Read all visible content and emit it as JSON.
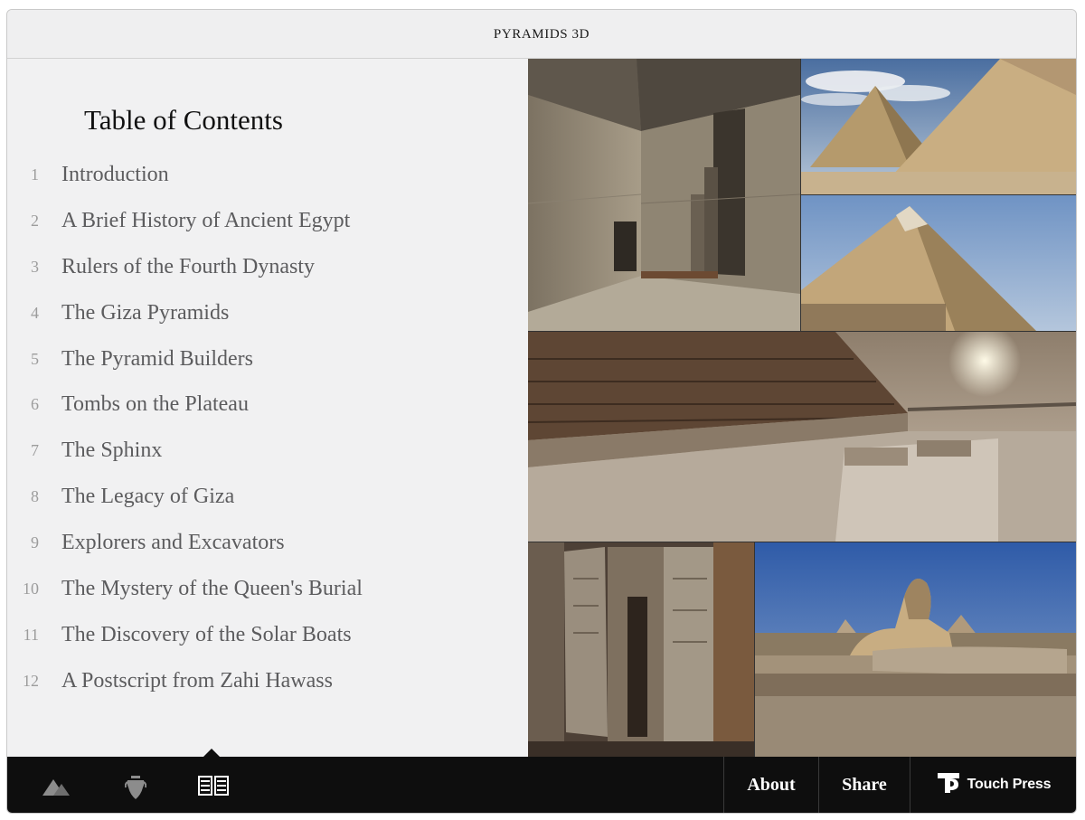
{
  "app": {
    "title": "PYRAMIDS 3D"
  },
  "toc": {
    "heading": "Table of Contents",
    "items": [
      {
        "num": "1",
        "label": "Introduction"
      },
      {
        "num": "2",
        "label": "A Brief History of Ancient Egypt"
      },
      {
        "num": "3",
        "label": "Rulers of the Fourth Dynasty"
      },
      {
        "num": "4",
        "label": "The Giza Pyramids"
      },
      {
        "num": "5",
        "label": "The Pyramid Builders"
      },
      {
        "num": "6",
        "label": "Tombs on the Plateau"
      },
      {
        "num": "7",
        "label": "The Sphinx"
      },
      {
        "num": "8",
        "label": "The Legacy of Giza"
      },
      {
        "num": "9",
        "label": "Explorers and Excavators"
      },
      {
        "num": "10",
        "label": "The Mystery of the Queen's Burial"
      },
      {
        "num": "11",
        "label": "The Discovery of the Solar Boats"
      },
      {
        "num": "12",
        "label": "A Postscript from Zahi Hawass"
      }
    ]
  },
  "toolbar": {
    "icons": [
      "pyramid-icon",
      "vase-icon",
      "book-icon"
    ],
    "active_icon": "book-icon",
    "about_label": "About",
    "share_label": "Share",
    "brand_label": "Touch Press"
  },
  "colors": {
    "toolbar_bg": "#0e0e0e",
    "toc_bg": "#f1f1f2",
    "toc_text": "#5c5c5e",
    "toc_number": "#9c9c9c"
  }
}
